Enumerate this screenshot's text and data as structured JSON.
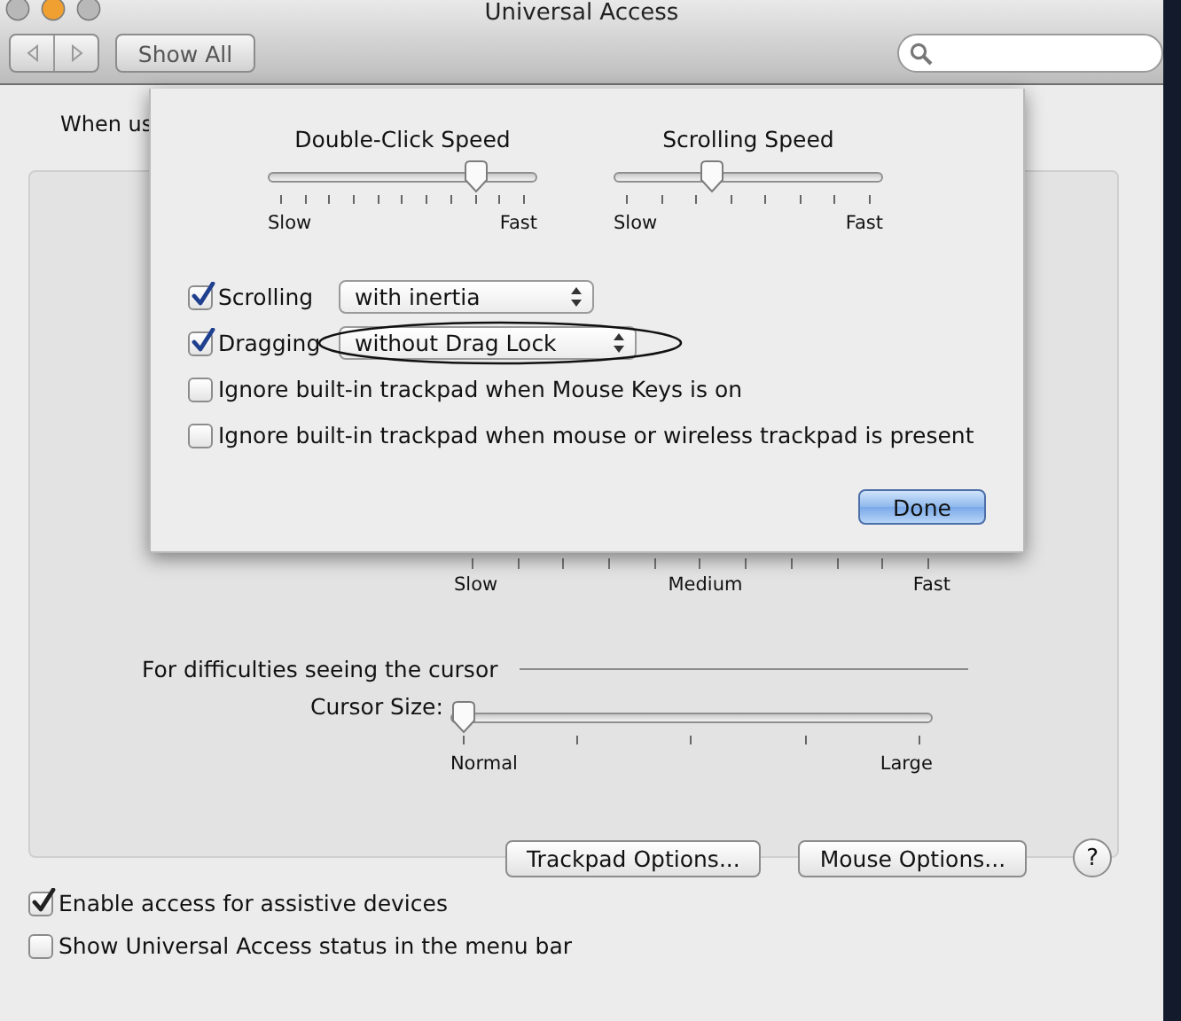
{
  "window": {
    "title": "Universal Access"
  },
  "toolbar": {
    "show_all": "Show All"
  },
  "background": {
    "intro": "When us",
    "speed_scale": [
      "Slow",
      "Medium",
      "Fast"
    ],
    "cursor_section": "For difficulties seeing the cursor",
    "cursor_size": {
      "label": "Cursor Size:",
      "level": 0,
      "min_label": "Normal",
      "max_label": "Large"
    },
    "buttons": [
      "Trackpad Options...",
      "Mouse Options..."
    ],
    "help": "?"
  },
  "options": [
    {
      "label": "Enable access for assistive devices",
      "checked": true
    },
    {
      "label": "Show Universal Access status in the menu bar",
      "checked": false
    }
  ],
  "sheet": {
    "sliders": [
      {
        "title": "Double-Click Speed",
        "level": 0.8,
        "min_label": "Slow",
        "max_label": "Fast"
      },
      {
        "title": "Scrolling Speed",
        "level": 0.35,
        "min_label": "Slow",
        "max_label": "Fast"
      }
    ],
    "rows": [
      {
        "kind": "popup",
        "label": "Scrolling",
        "checked": true,
        "value": "with inertia",
        "circled": false
      },
      {
        "kind": "popup",
        "label": "Dragging",
        "checked": true,
        "value": "without Drag Lock",
        "circled": true
      },
      {
        "kind": "check",
        "label": "Ignore built-in trackpad when Mouse Keys is on",
        "checked": false
      },
      {
        "kind": "check",
        "label": "Ignore built-in trackpad when mouse or wireless trackpad is present",
        "checked": false
      }
    ],
    "done": "Done"
  }
}
